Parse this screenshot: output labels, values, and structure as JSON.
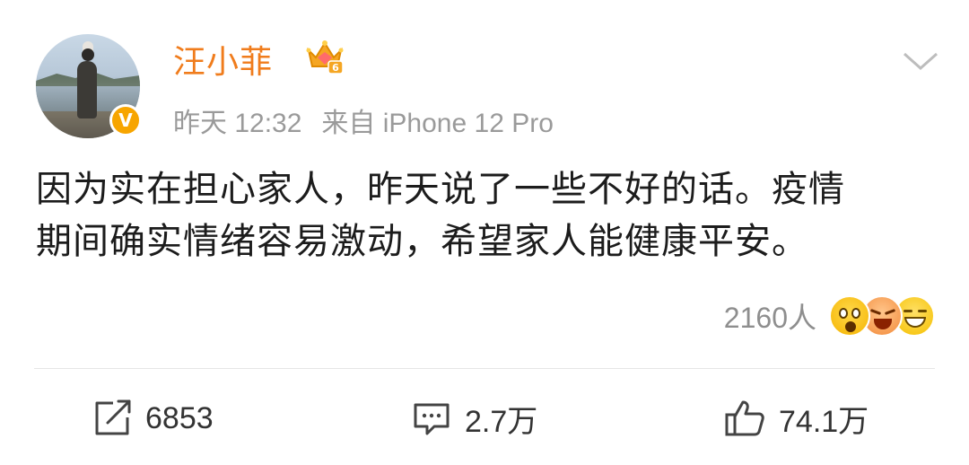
{
  "user": {
    "name": "汪小菲",
    "verified_badge": "V",
    "level_badge": "6"
  },
  "meta": {
    "time": "昨天 12:32",
    "source": "来自 iPhone 12 Pro"
  },
  "post": {
    "line1": "因为实在担心家人，昨天说了一些不好的话。疫情",
    "line2": "期间确实情绪容易激动，希望家人能健康平安。"
  },
  "reactions": {
    "count": "2160人",
    "emojis": [
      "surprised-emoji",
      "laughing-emoji",
      "grin-emoji"
    ]
  },
  "actions": {
    "repost_count": "6853",
    "comment_count": "2.7万",
    "like_count": "74.1万"
  },
  "colors": {
    "name": "#f07c1c",
    "verified": "#f7a500",
    "meta": "#9a9a9a"
  }
}
